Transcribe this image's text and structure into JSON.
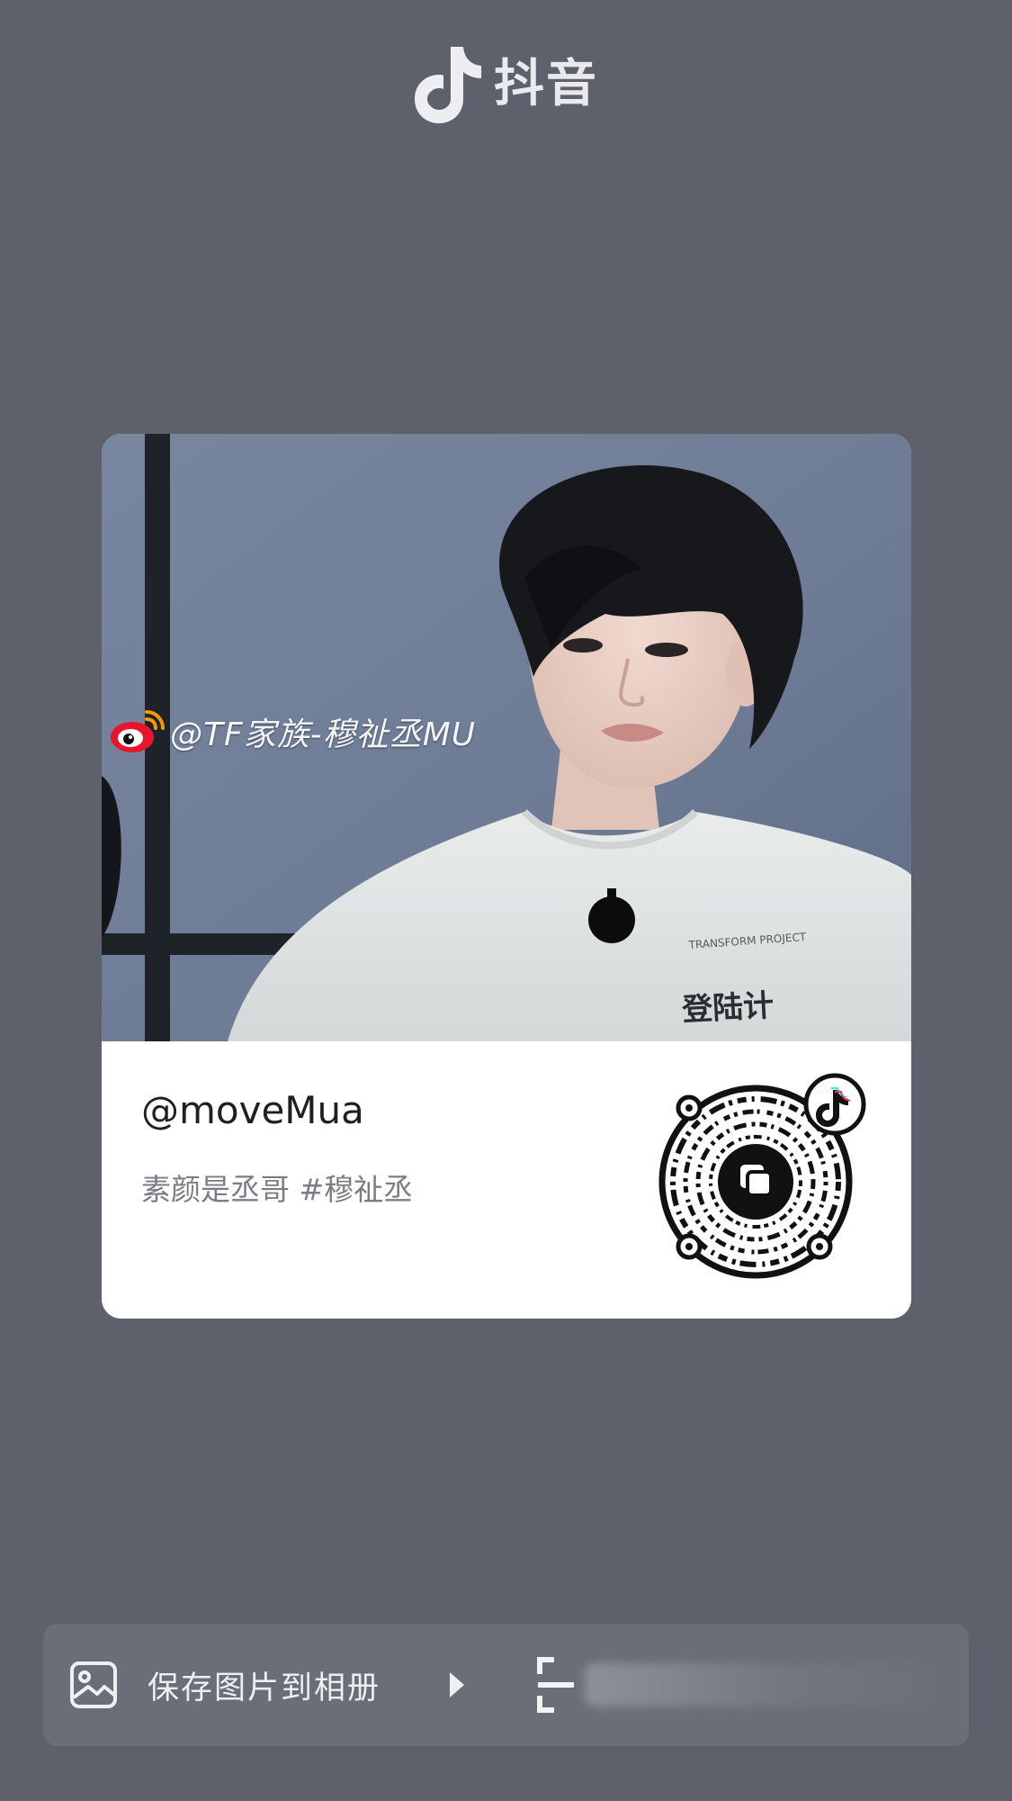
{
  "header": {
    "app_name": "抖音",
    "logo_icon": "tiktok-note-icon"
  },
  "card": {
    "cover": {
      "watermark_icon": "weibo-icon",
      "watermark_text": "@TF家族-穆祉丞MU",
      "shirt_print": "登陆计"
    },
    "username": "@moveMua",
    "caption": "素颜是丞哥 #穆祉丞",
    "qr_icon": "douyin-qr-code-icon"
  },
  "actions": {
    "save_label": "保存图片到相册",
    "save_icon": "gallery-icon",
    "expand_icon": "play-arrow-icon",
    "scan_icon": "scan-icon"
  },
  "colors": {
    "background": "#5e616b",
    "action_bar": "#6b6e77",
    "card": "#ffffff",
    "caption": "#7b7d85"
  }
}
